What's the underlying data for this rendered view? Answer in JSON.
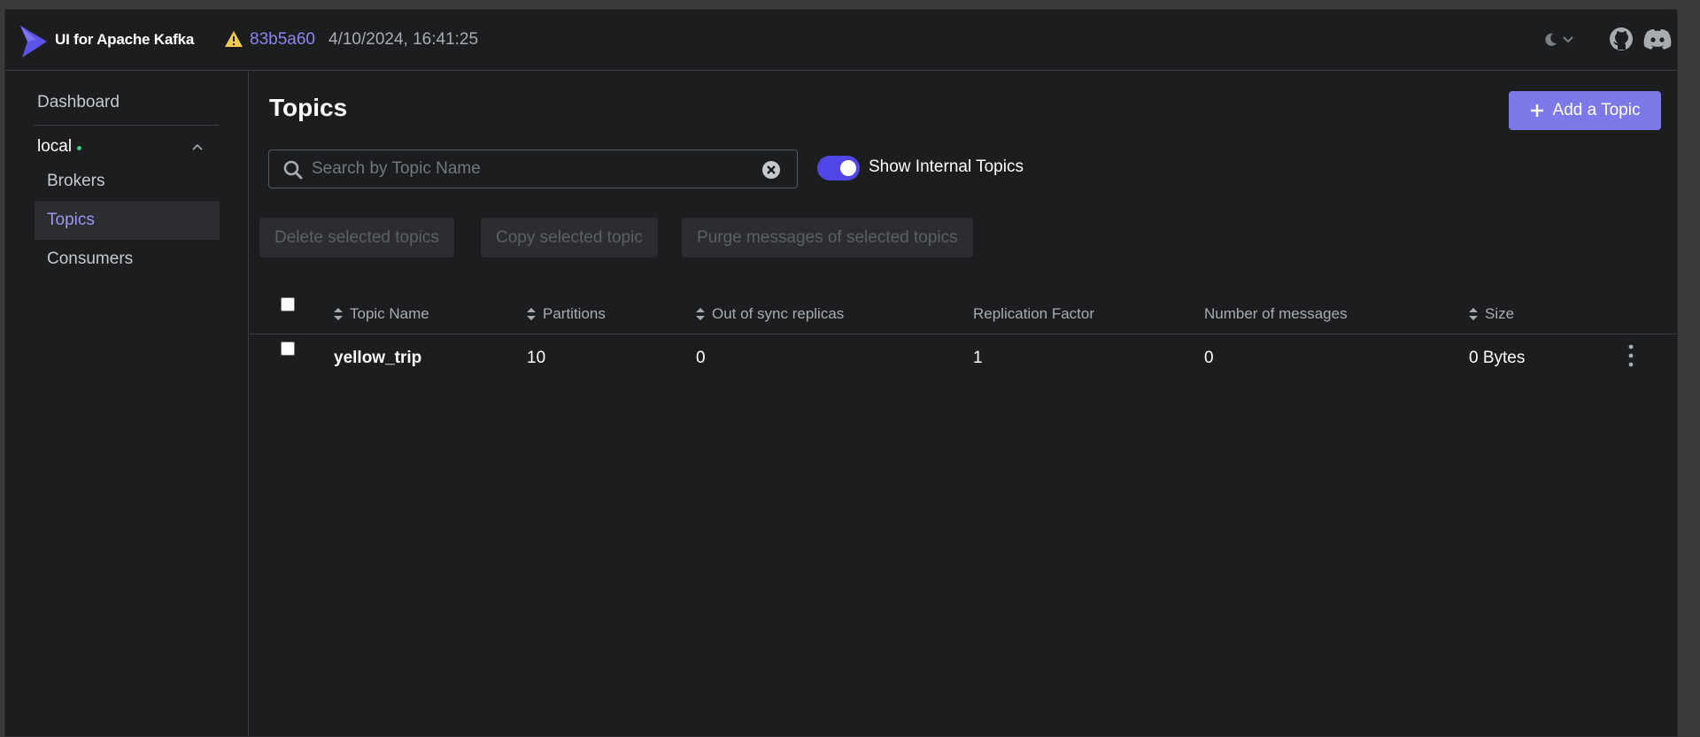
{
  "header": {
    "app_title": "UI for Apache Kafka",
    "commit": "83b5a60",
    "build_date": "4/10/2024, 16:41:25"
  },
  "sidebar": {
    "dashboard": "Dashboard",
    "cluster": "local",
    "items": [
      {
        "label": "Brokers"
      },
      {
        "label": "Topics"
      },
      {
        "label": "Consumers"
      }
    ]
  },
  "main": {
    "title": "Topics",
    "add_topic_label": "Add a Topic",
    "search_placeholder": "Search by Topic Name",
    "show_internal_label": "Show Internal Topics",
    "show_internal_enabled": true,
    "bulk_actions": [
      "Delete selected topics",
      "Copy selected topic",
      "Purge messages of selected topics"
    ],
    "table": {
      "headers": [
        "Topic Name",
        "Partitions",
        "Out of sync replicas",
        "Replication Factor",
        "Number of messages",
        "Size"
      ],
      "rows": [
        {
          "name": "yellow_trip",
          "partitions": "10",
          "out_of_sync": "0",
          "replication_factor": "1",
          "messages": "0",
          "size": "0 Bytes"
        }
      ]
    }
  },
  "colors": {
    "accent": "#7d79e8",
    "toggle": "#4f46e5",
    "status_online": "#3ec97a",
    "warning": "#f2c94c"
  }
}
